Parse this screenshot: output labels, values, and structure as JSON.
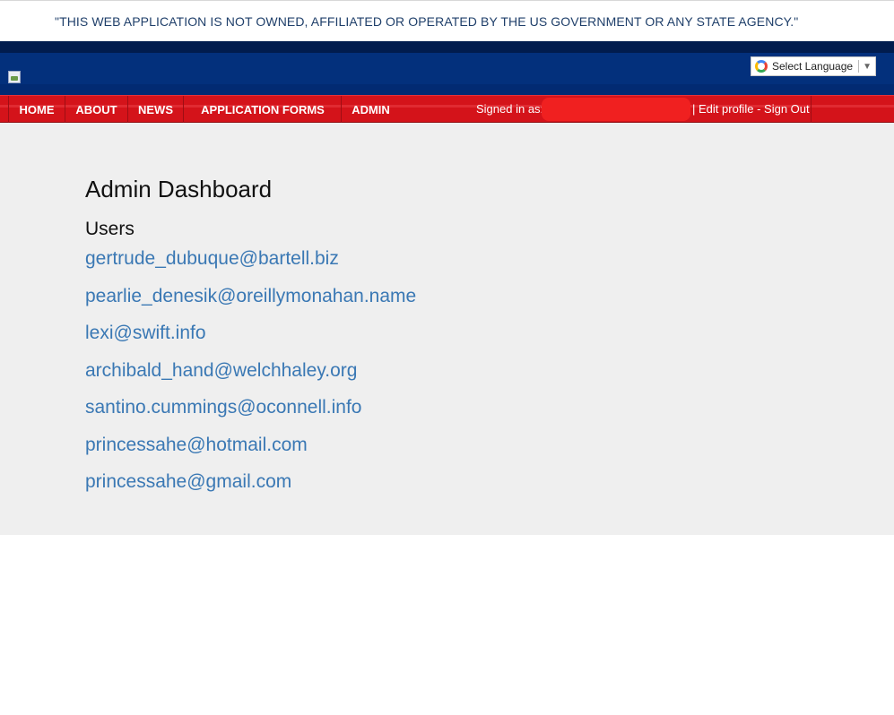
{
  "disclaimer": "\"THIS WEB APPLICATION IS NOT OWNED, AFFILIATED OR OPERATED BY THE US GOVERNMENT OR ANY STATE AGENCY.\"",
  "language_selector": {
    "label": "Select Language",
    "caret": "▼",
    "icon": "google-g-icon"
  },
  "nav": {
    "items": [
      {
        "label": "HOME"
      },
      {
        "label": "ABOUT"
      },
      {
        "label": "NEWS"
      },
      {
        "label": "APPLICATION FORMS"
      },
      {
        "label": "ADMIN"
      }
    ],
    "signed_in_label": "Signed in as:",
    "separator": "|",
    "edit_profile": "Edit profile",
    "dash": "-",
    "sign_out": "Sign Out"
  },
  "dashboard": {
    "title": "Admin Dashboard",
    "users_heading": "Users",
    "users": [
      "gertrude_dubuque@bartell.biz",
      "pearlie_denesik@oreillymonahan.name",
      "lexi@swift.info",
      "archibald_hand@welchhaley.org",
      "santino.cummings@oconnell.info",
      "princessahe@hotmail.com",
      "princessahe@gmail.com"
    ]
  },
  "colors": {
    "header_blue": "#022a72",
    "nav_red": "#d4131a",
    "link_blue": "#3a78b4",
    "panel_gray": "#efefef"
  }
}
